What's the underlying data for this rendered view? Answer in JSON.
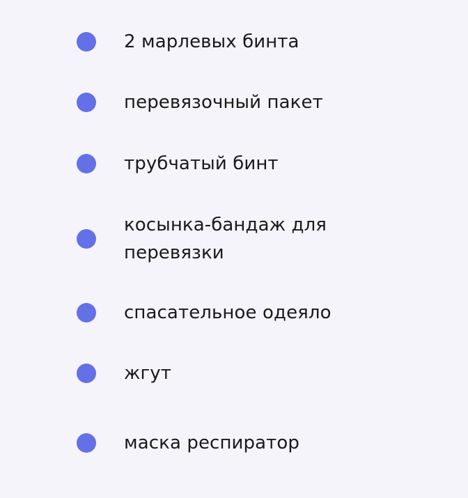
{
  "colors": {
    "background": "#f4f4fa",
    "bullet": "#6470e6",
    "text": "#1a1a1a"
  },
  "list": {
    "items": [
      {
        "label": "2 марлевых бинта"
      },
      {
        "label": "перевязочный пакет"
      },
      {
        "label": "трубчатый бинт"
      },
      {
        "label": "косынка-бандаж для перевязки"
      },
      {
        "label": "спасательное одеяло"
      },
      {
        "label": "жгут"
      },
      {
        "label": "маска респиратор"
      }
    ]
  }
}
